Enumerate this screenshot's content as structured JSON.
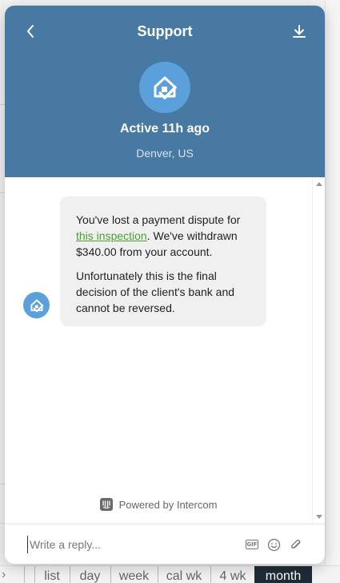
{
  "header": {
    "title": "Support",
    "status": "Active 11h ago",
    "location": "Denver, US"
  },
  "message": {
    "p1_before": "You've lost a payment dispute for ",
    "p1_link": "this inspection",
    "p1_after": ". We've withdrawn $340.00 from your account.",
    "p2": "Unfortunately this is the final decision of the client's bank and cannot be reversed."
  },
  "footer": {
    "powered_by": "Powered by Intercom"
  },
  "composer": {
    "placeholder": "Write a reply..."
  },
  "background_tabs": [
    {
      "label": "list",
      "active": false
    },
    {
      "label": "day",
      "active": false
    },
    {
      "label": "week",
      "active": false
    },
    {
      "label": "cal wk",
      "active": false
    },
    {
      "label": "4 wk",
      "active": false
    },
    {
      "label": "month",
      "active": true
    }
  ],
  "colors": {
    "header_bg": "#4779a2",
    "avatar_bg": "#5b9fdb",
    "link": "#4aa12d",
    "bubble_bg": "#f0f0f0"
  },
  "icons": {
    "back": "chevron-left-icon",
    "download": "download-icon",
    "avatar": "house-check-icon",
    "gif": "gif-icon",
    "emoji": "smiley-icon",
    "attach": "paperclip-icon",
    "intercom": "intercom-logo-icon"
  }
}
